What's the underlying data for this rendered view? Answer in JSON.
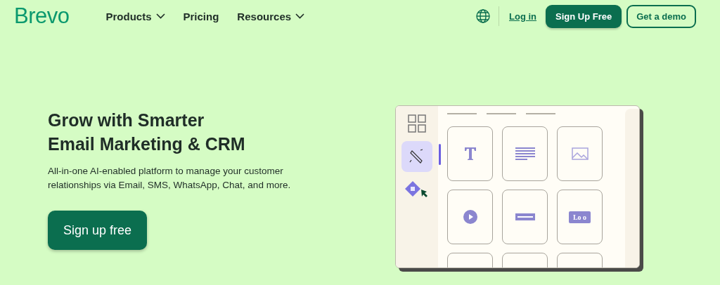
{
  "header": {
    "logo": "Brevo",
    "nav": [
      {
        "label": "Products",
        "dropdown": true
      },
      {
        "label": "Pricing",
        "dropdown": false
      },
      {
        "label": "Resources",
        "dropdown": true
      }
    ],
    "login": "Log in",
    "signup": "Sign Up Free",
    "demo": "Get a demo"
  },
  "hero": {
    "title_lines": [
      "Grow with Smarter",
      "Email Marketing & CRM"
    ],
    "subtitle": "All-in-one AI-enabled platform to manage your customer relationships via Email, SMS, WhatsApp, Chat, and more.",
    "cta": "Sign up free"
  },
  "editor": {
    "tools": [
      {
        "kind": "grid",
        "selected": false
      },
      {
        "kind": "pen",
        "selected": true
      },
      {
        "kind": "ai",
        "selected": false
      }
    ],
    "blocks": [
      {
        "kind": "title"
      },
      {
        "kind": "text"
      },
      {
        "kind": "image"
      },
      {
        "kind": "video"
      },
      {
        "kind": "button"
      },
      {
        "kind": "logo",
        "label": "Lo o"
      },
      {
        "kind": "empty"
      },
      {
        "kind": "empty"
      },
      {
        "kind": "empty"
      }
    ]
  }
}
